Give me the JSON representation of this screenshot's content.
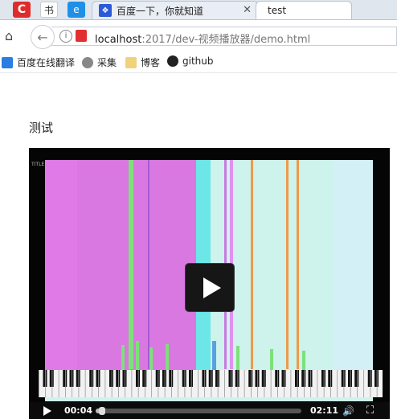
{
  "browser": {
    "pinned_tabs": [
      "C",
      "书",
      "e"
    ],
    "tabs": [
      {
        "title": "百度一下，你就知道",
        "favicon": "baidu-paw-icon"
      },
      {
        "title": "test"
      }
    ],
    "tab_close_glyph": "✕",
    "address": {
      "host": "localhost",
      "path": ":2017/dev-视频播放器/demo.html"
    },
    "bookmarks": [
      {
        "label": "百度在线翻译",
        "icon": "translate-icon",
        "color": "#2a7de1"
      },
      {
        "label": "采集",
        "icon": "globe-icon",
        "color": "#777777"
      },
      {
        "label": "博客",
        "icon": "folder-icon",
        "color": "#f0d27a"
      },
      {
        "label": "github",
        "icon": "github-icon",
        "color": "#222222"
      }
    ]
  },
  "page": {
    "heading": "测试"
  },
  "video": {
    "frame_label": "TITLE",
    "current_time": "00:04",
    "duration": "02:11",
    "progress_fraction": 0.03,
    "colors": {
      "pink": "#e07ae6",
      "mint": "#cdf3ec",
      "cyan": "#6de6e8",
      "orange": "#ef9a48",
      "green": "#7ee07a"
    }
  }
}
